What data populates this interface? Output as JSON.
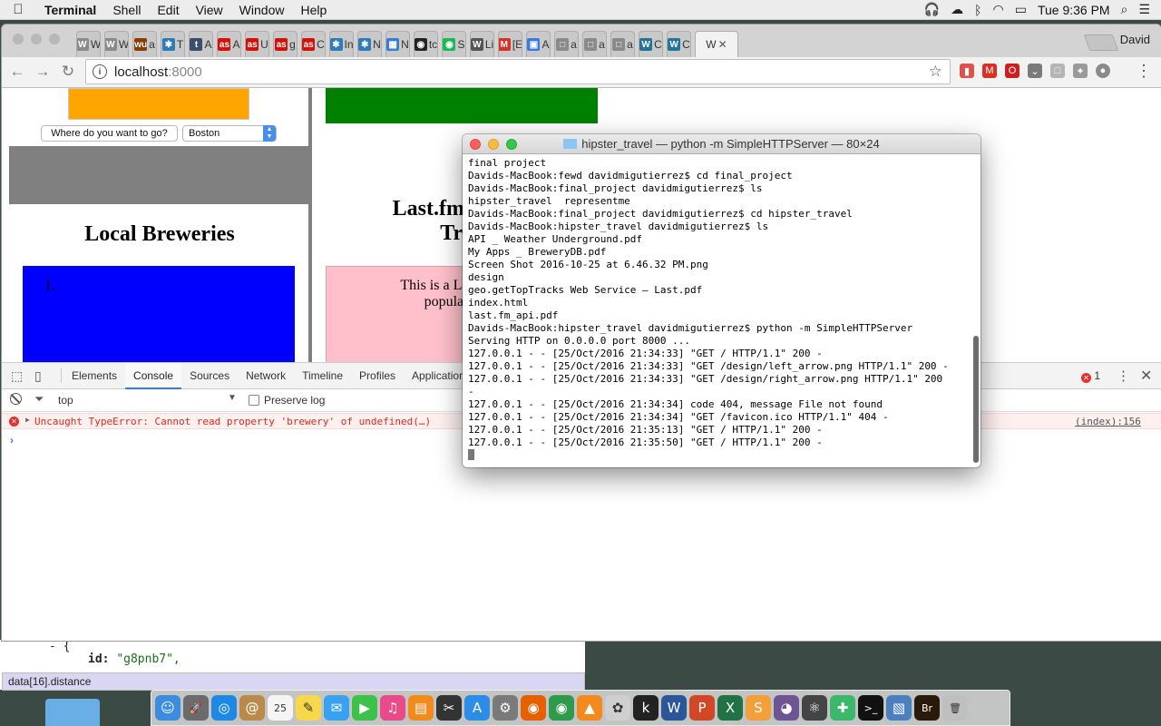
{
  "menubar": {
    "app_name": "Terminal",
    "items": [
      "Shell",
      "Edit",
      "View",
      "Window",
      "Help"
    ],
    "clock": "Tue 9:36 PM"
  },
  "chrome": {
    "tabs": [
      {
        "fav": "W",
        "label": "W",
        "color": "#8a8a8a"
      },
      {
        "fav": "W",
        "label": "W",
        "color": "#8a8a8a"
      },
      {
        "fav": "wu",
        "label": "a",
        "color": "#8a3b00"
      },
      {
        "fav": "✱",
        "label": "T",
        "color": "#2d7bb8"
      },
      {
        "fav": "t",
        "label": "A",
        "color": "#3a4f6e"
      },
      {
        "fav": "as",
        "label": "A",
        "color": "#d51007"
      },
      {
        "fav": "as",
        "label": "U",
        "color": "#d51007"
      },
      {
        "fav": "as",
        "label": "g",
        "color": "#d51007"
      },
      {
        "fav": "as",
        "label": "C",
        "color": "#d51007"
      },
      {
        "fav": "✱",
        "label": "In",
        "color": "#2d7bb8"
      },
      {
        "fav": "✱",
        "label": "N",
        "color": "#2d7bb8"
      },
      {
        "fav": "▦",
        "label": "N",
        "color": "#3a7bd5"
      },
      {
        "fav": "◉",
        "label": "tc",
        "color": "#222222"
      },
      {
        "fav": "◉",
        "label": "S",
        "color": "#1db954"
      },
      {
        "fav": "W",
        "label": "Li",
        "color": "#555555"
      },
      {
        "fav": "M",
        "label": "[E",
        "color": "#d93025"
      },
      {
        "fav": "▣",
        "label": "A",
        "color": "#3b78e7"
      },
      {
        "fav": "□",
        "label": "a",
        "color": "#8a8a8a"
      },
      {
        "fav": "□",
        "label": "a",
        "color": "#8a8a8a"
      },
      {
        "fav": "□",
        "label": "a",
        "color": "#8a8a8a"
      },
      {
        "fav": "W",
        "label": "C",
        "color": "#21759b"
      },
      {
        "fav": "W",
        "label": "C",
        "color": "#21759b"
      }
    ],
    "active_tab_label": "W",
    "profile_name": "David",
    "url_host": "localhost",
    "url_port": ":8000"
  },
  "page": {
    "where_button": "Where do you want to go?",
    "city_selected": "Boston",
    "breweries_title": "Local Breweries",
    "brewery_list_marker": "1.",
    "lastfm_title_line1": "Last.fm Most I",
    "lastfm_title_line2": "Trac",
    "lastfm_desc_line1": "This is a Last.fm grid",
    "lastfm_desc_line2": "popular track"
  },
  "devtools": {
    "tabs": [
      "Elements",
      "Console",
      "Sources",
      "Network",
      "Timeline",
      "Profiles",
      "Application"
    ],
    "active_tab": "Console",
    "error_count": "1",
    "context": "top",
    "preserve_log_label": "Preserve log",
    "error_message": "Uncaught TypeError: Cannot read property 'brewery' of undefined(…)",
    "error_source": "(index):156",
    "prompt": "›"
  },
  "terminal": {
    "title": "hipster_travel — python -m SimpleHTTPServer — 80×24",
    "lines": [
      "final project",
      "Davids-MacBook:fewd davidmigutierrez$ cd final_project",
      "Davids-MacBook:final_project davidmigutierrez$ ls",
      "hipster_travel  representme",
      "Davids-MacBook:final_project davidmigutierrez$ cd hipster_travel",
      "Davids-MacBook:hipster_travel davidmigutierrez$ ls",
      "API _ Weather Underground.pdf",
      "My Apps _ BreweryDB.pdf",
      "Screen Shot 2016-10-25 at 6.46.32 PM.png",
      "design",
      "geo.getTopTracks Web Service — Last.pdf",
      "index.html",
      "last.fm_api.pdf",
      "Davids-MacBook:hipster_travel davidmigutierrez$ python -m SimpleHTTPServer",
      "Serving HTTP on 0.0.0.0 port 8000 ...",
      "127.0.0.1 - - [25/Oct/2016 21:34:33] \"GET / HTTP/1.1\" 200 -",
      "127.0.0.1 - - [25/Oct/2016 21:34:33] \"GET /design/left_arrow.png HTTP/1.1\" 200 -",
      "127.0.0.1 - - [25/Oct/2016 21:34:33] \"GET /design/right_arrow.png HTTP/1.1\" 200",
      "-",
      "127.0.0.1 - - [25/Oct/2016 21:34:34] code 404, message File not found",
      "127.0.0.1 - - [25/Oct/2016 21:34:34] \"GET /favicon.ico HTTP/1.1\" 404 -",
      "127.0.0.1 - - [25/Oct/2016 21:35:13] \"GET / HTTP/1.1\" 200 -",
      "127.0.0.1 - - [25/Oct/2016 21:35:50] \"GET / HTTP/1.1\" 200 -"
    ]
  },
  "background_editor": {
    "line1": "- {",
    "line2_key": "id:",
    "line2_val": "\"g8pnb7\",",
    "status_path": "data[16].distance"
  },
  "dock": {
    "apps": [
      {
        "icon": "finder-icon",
        "glyph": "☺",
        "color": "#3b8de0"
      },
      {
        "icon": "launchpad-icon",
        "glyph": "🚀",
        "color": "#6b6b6b"
      },
      {
        "icon": "safari-icon",
        "glyph": "◎",
        "color": "#1e88e5"
      },
      {
        "icon": "contacts-icon",
        "glyph": "@",
        "color": "#b98a4a"
      },
      {
        "icon": "calendar-icon",
        "glyph": "25",
        "color": "#f5f5f5"
      },
      {
        "icon": "notes-icon",
        "glyph": "✎",
        "color": "#f6d84a"
      },
      {
        "icon": "messages-icon",
        "glyph": "✉",
        "color": "#3aa0f0"
      },
      {
        "icon": "facetime-icon",
        "glyph": "▶",
        "color": "#3cc24a"
      },
      {
        "icon": "itunes-icon",
        "glyph": "♫",
        "color": "#e84a8a"
      },
      {
        "icon": "ibooks-icon",
        "glyph": "▤",
        "color": "#f28a1e"
      },
      {
        "icon": "final-cut-icon",
        "glyph": "✂",
        "color": "#333333"
      },
      {
        "icon": "app-store-icon",
        "glyph": "A",
        "color": "#2b8de8"
      },
      {
        "icon": "system-prefs-icon",
        "glyph": "⚙",
        "color": "#7a7a7a"
      },
      {
        "icon": "firefox-icon",
        "glyph": "◉",
        "color": "#e66000"
      },
      {
        "icon": "chrome-icon",
        "glyph": "◉",
        "color": "#2e9a4a"
      },
      {
        "icon": "vlc-icon",
        "glyph": "▲",
        "color": "#f28a1e"
      },
      {
        "icon": "photos-icon",
        "glyph": "✿",
        "color": "#cfcfcf"
      },
      {
        "icon": "kindle-icon",
        "glyph": "k",
        "color": "#222222"
      },
      {
        "icon": "word-icon",
        "glyph": "W",
        "color": "#2b579a"
      },
      {
        "icon": "powerpoint-icon",
        "glyph": "P",
        "color": "#d24726"
      },
      {
        "icon": "excel-icon",
        "glyph": "X",
        "color": "#217346"
      },
      {
        "icon": "sublime-icon",
        "glyph": "S",
        "color": "#f2a03a"
      },
      {
        "icon": "github-icon",
        "glyph": "◕",
        "color": "#6e5494"
      },
      {
        "icon": "atom-icon",
        "glyph": "⚛",
        "color": "#444444"
      },
      {
        "icon": "xmind-icon",
        "glyph": "✚",
        "color": "#3cb86a"
      },
      {
        "icon": "terminal-icon",
        "glyph": ">_",
        "color": "#111111"
      },
      {
        "icon": "preview-icon",
        "glyph": "▧",
        "color": "#4a7fc0"
      },
      {
        "icon": "bridge-icon",
        "glyph": "Br",
        "color": "#2a1a0a"
      },
      {
        "icon": "trash-icon",
        "glyph": "🗑",
        "color": "#bfbfbf"
      }
    ]
  }
}
